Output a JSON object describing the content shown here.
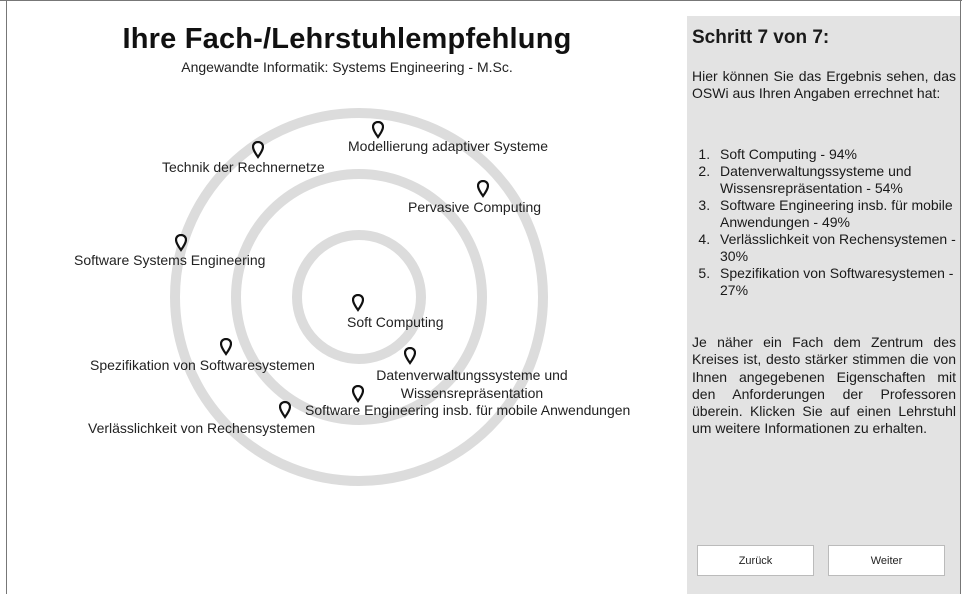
{
  "main": {
    "title": "Ihre Fach-/Lehrstuhlempfehlung",
    "subtitle": "Angewandte Informatik: Systems Engineering - M.Sc."
  },
  "recommendations": [
    {
      "label": "Modellierung adaptiver Systeme"
    },
    {
      "label": "Technik der Rechnernetze"
    },
    {
      "label": "Pervasive Computing"
    },
    {
      "label": "Software Systems Engineering"
    },
    {
      "label": "Soft Computing"
    },
    {
      "label": "Spezifikation von Softwaresystemen"
    },
    {
      "label": "Datenverwaltungssysteme und Wissensrepräsentation"
    },
    {
      "label": "Software Engineering insb. für mobile Anwendungen"
    },
    {
      "label": "Verlässlichkeit von Rechensystemen"
    }
  ],
  "panel": {
    "step_title": "Schritt 7 von 7:",
    "intro": "Hier können Sie das Ergebnis sehen, das OSWi aus Ihren Angaben errechnet hat:",
    "ranking": [
      "Soft Computing - 94%",
      "Datenverwaltungssysteme und Wissensrepräsentation - 54%",
      "Software Engineering insb. für mobile Anwendungen - 49%",
      "Verlässlichkeit von Rechensystemen - 30%",
      "Spezifikation von Softwaresystemen - 27%"
    ],
    "explanation": "Je näher ein Fach dem Zentrum des Kreises ist, desto stärker stimmen die von Ihnen angegebenen Eigenschaften mit den Anforderungen der Professoren überein. Klicken Sie auf einen Lehrstuhl um weitere Informationen zu erhalten.",
    "back_label": "Zurück",
    "next_label": "Weiter"
  },
  "colors": {
    "ring": "#dcdcdc",
    "panel_bg": "#e3e3e3",
    "pin": "#111111"
  },
  "icons": {
    "pin": "map-pin-icon"
  }
}
